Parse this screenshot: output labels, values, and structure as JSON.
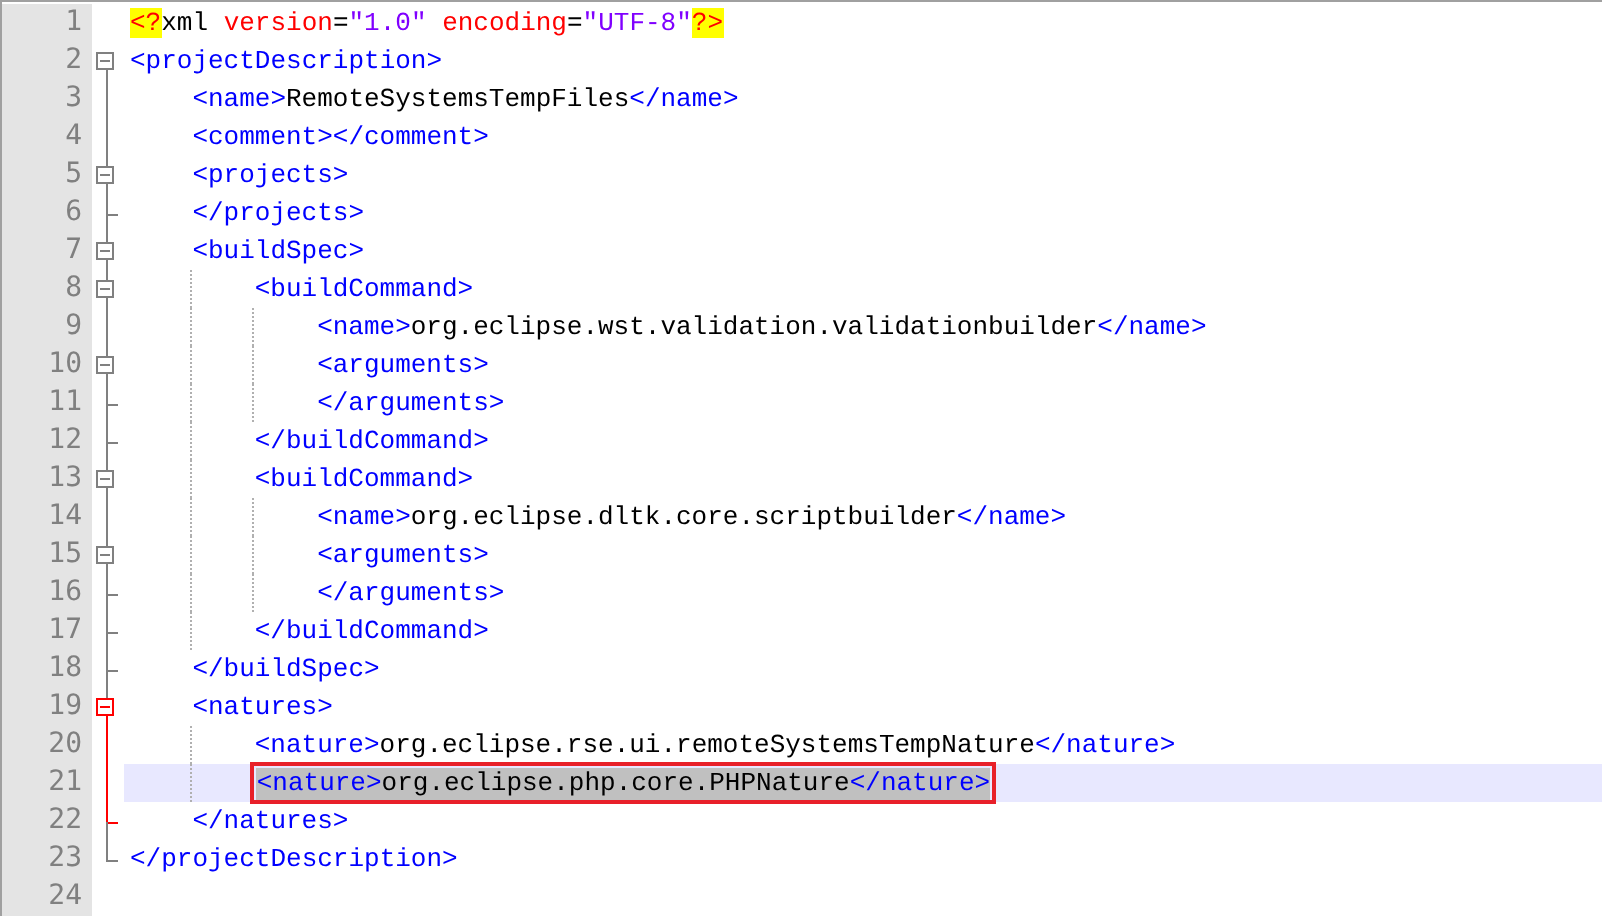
{
  "editor": {
    "lines": [
      {
        "number": "1",
        "kind": "plain",
        "tokens": [
          {
            "kind": "pi",
            "text": "<?"
          },
          {
            "kind": "name",
            "text": "xml"
          },
          {
            "kind": "attr",
            "text": " version"
          },
          {
            "kind": "plain",
            "text": "="
          },
          {
            "kind": "value",
            "text": "\"1.0\""
          },
          {
            "kind": "attr",
            "text": " encoding"
          },
          {
            "kind": "plain",
            "text": "="
          },
          {
            "kind": "value",
            "text": "\"UTF-8\""
          },
          {
            "kind": "pi",
            "text": "?>"
          }
        ]
      },
      {
        "number": "2",
        "kind": "fold_start",
        "tokens": [
          {
            "kind": "tag",
            "text": "<projectDescription>"
          }
        ],
        "children": [
          {
            "number": "3",
            "kind": "plain",
            "tokens": [
              {
                "kind": "tag",
                "text": "<name>"
              },
              {
                "kind": "text",
                "text": "RemoteSystemsTempFiles"
              },
              {
                "kind": "tag",
                "text": "</name>"
              }
            ]
          },
          {
            "number": "4",
            "kind": "plain",
            "tokens": [
              {
                "kind": "tag",
                "text": "<comment></comment>"
              }
            ]
          },
          {
            "number": "5",
            "kind": "fold_start",
            "tokens": [
              {
                "kind": "tag",
                "text": "<projects>"
              }
            ],
            "children": [
              {
                "number": "6",
                "kind": "fold_end",
                "tokens": [
                  {
                    "kind": "tag",
                    "text": "</projects>"
                  }
                ]
              }
            ]
          },
          {
            "number": "7",
            "kind": "fold_start",
            "tokens": [
              {
                "kind": "tag",
                "text": "<buildSpec>"
              }
            ],
            "children": [
              {
                "number": "8",
                "kind": "fold_start",
                "tokens": [
                  {
                    "kind": "tag",
                    "text": "<buildCommand>"
                  }
                ],
                "children": [
                  {
                    "number": "9",
                    "kind": "plain",
                    "tokens": [
                      {
                        "kind": "tag",
                        "text": "<name>"
                      },
                      {
                        "kind": "text",
                        "text": "org.eclipse.wst.validation.validationbuilder"
                      },
                      {
                        "kind": "tag",
                        "text": "</name>"
                      }
                    ]
                  },
                  {
                    "number": "10",
                    "kind": "fold_start",
                    "tokens": [
                      {
                        "kind": "tag",
                        "text": "<arguments>"
                      }
                    ],
                    "children": [
                      {
                        "number": "11",
                        "kind": "fold_end",
                        "tokens": [
                          {
                            "kind": "tag",
                            "text": "</arguments>"
                          }
                        ]
                      }
                    ]
                  },
                  {
                    "number": "12",
                    "kind": "fold_end",
                    "tokens": [
                      {
                        "kind": "tag",
                        "text": "</buildCommand>"
                      }
                    ]
                  }
                ]
              },
              {
                "number": "13",
                "kind": "fold_start",
                "tokens": [
                  {
                    "kind": "tag",
                    "text": "<buildCommand>"
                  }
                ],
                "children": [
                  {
                    "number": "14",
                    "kind": "plain",
                    "tokens": [
                      {
                        "kind": "tag",
                        "text": "<name>"
                      },
                      {
                        "kind": "text",
                        "text": "org.eclipse.dltk.core.scriptbuilder"
                      },
                      {
                        "kind": "tag",
                        "text": "</name>"
                      }
                    ]
                  },
                  {
                    "number": "15",
                    "kind": "fold_start",
                    "tokens": [
                      {
                        "kind": "tag",
                        "text": "<arguments>"
                      }
                    ],
                    "children": [
                      {
                        "number": "16",
                        "kind": "fold_end",
                        "tokens": [
                          {
                            "kind": "tag",
                            "text": "</arguments>"
                          }
                        ]
                      }
                    ]
                  },
                  {
                    "number": "17",
                    "kind": "fold_end",
                    "tokens": [
                      {
                        "kind": "tag",
                        "text": "</buildCommand>"
                      }
                    ]
                  }
                ]
              },
              {
                "number": "18",
                "kind": "fold_end",
                "tokens": [
                  {
                    "kind": "tag",
                    "text": "</buildSpec>"
                  }
                ]
              }
            ]
          },
          {
            "number": "19",
            "kind": "fold_start",
            "current": true,
            "tokens": [
              {
                "kind": "tag",
                "text": "<natures>"
              }
            ],
            "children": [
              {
                "number": "20",
                "kind": "plain",
                "tokens": [
                  {
                    "kind": "tag",
                    "text": "<nature>"
                  },
                  {
                    "kind": "text",
                    "text": "org.eclipse.rse.ui.remoteSystemsTempNature"
                  },
                  {
                    "kind": "tag",
                    "text": "</nature>"
                  }
                ]
              },
              {
                "number": "21",
                "kind": "plain",
                "selected": true,
                "boxed": true,
                "tokens": [
                  {
                    "kind": "tag",
                    "text": "<nature>"
                  },
                  {
                    "kind": "text",
                    "text": "org.eclipse.php.core.PHPNature"
                  },
                  {
                    "kind": "tag",
                    "text": "</nature>"
                  }
                ]
              },
              {
                "number": "22",
                "kind": "fold_end",
                "tokens": [
                  {
                    "kind": "tag",
                    "text": "</natures>"
                  }
                ]
              }
            ]
          },
          {
            "number": "23",
            "kind": "fold_end",
            "tokens": [
              {
                "kind": "tag",
                "text": "</projectDescription>"
              }
            ]
          }
        ]
      },
      {
        "number": "24",
        "kind": "plain"
      }
    ]
  }
}
